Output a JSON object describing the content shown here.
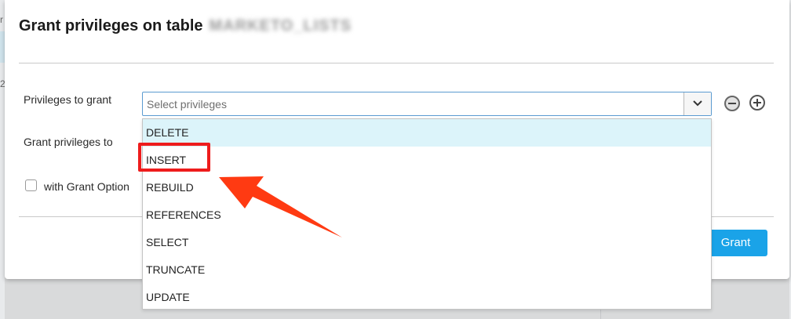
{
  "background": {
    "fragment_1": "r",
    "fragment_2": "2"
  },
  "dialog": {
    "title": "Grant privileges on table",
    "table_name_redacted": "MARKETO_LISTS",
    "privileges_label": "Privileges to grant",
    "privileges_placeholder": "Select privileges",
    "grant_to_label": "Grant privileges to",
    "with_grant_option_label": "with Grant Option",
    "with_grant_option_checked": false,
    "grant_button": "Grant"
  },
  "dropdown": {
    "highlighted_index": 0,
    "options": [
      "DELETE",
      "INSERT",
      "REBUILD",
      "REFERENCES",
      "SELECT",
      "TRUNCATE",
      "UPDATE"
    ]
  },
  "annotation": {
    "highlighted_option": "INSERT",
    "box_color": "#ee1c1c",
    "arrow_color": "#ff3a12"
  },
  "colors": {
    "accent": "#1aa3e8",
    "highlight_row": "#dcf4fa",
    "select_border": "#5b9bd1"
  }
}
